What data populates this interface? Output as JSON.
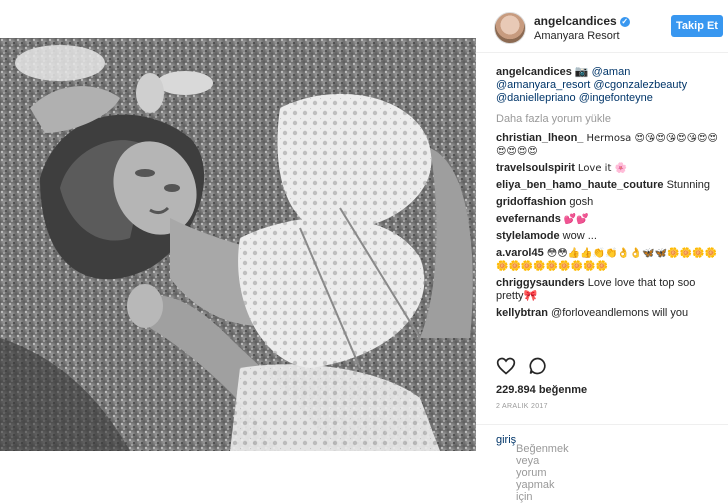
{
  "post": {
    "username": "angelcandices",
    "location": "Amanyara Resort",
    "follow_label": "Takip Et",
    "caption_user": "angelcandices",
    "caption_text": "📷 @aman @amanyara_resort @cgonzalezbeauty @daniellepriano @ingefonteyne",
    "load_more": "Daha fazla yorum yükle",
    "likes": "229.894 beğenme",
    "date": "2 ARALIK 2017",
    "footer_text": "Beğenmek veya yorum yapmak için ",
    "footer_link": "giriş"
  },
  "comments": [
    {
      "user": "christian_lheon_",
      "text": "Hermosa 😍😘😍😘😍😘😍😍😍😍😍😍"
    },
    {
      "user": "travelsoulspirit",
      "text": "Love it 🌸"
    },
    {
      "user": "eliya_ben_hamo_haute_couture",
      "text": "Stunning"
    },
    {
      "user": "gridoffashion",
      "text": "gosh"
    },
    {
      "user": "evefernands",
      "text": "💕💕"
    },
    {
      "user": "stylelamode",
      "text": "wow ..."
    },
    {
      "user": "a.varol45",
      "text": "😳😳👍👍👏👏👌👌🦋🦋🌼🌼🌼🌼🌼🌼🌼🌼🌼🌼🌼🌼🌼"
    },
    {
      "user": "chriggysaunders",
      "text": "Love love that top soo pretty🎀"
    },
    {
      "user": "kellybtran",
      "text": "@forloveandlemons will you"
    }
  ],
  "icons": {
    "heart": "heart-icon",
    "comment": "comment-icon",
    "verified": "verified-icon"
  },
  "colors": {
    "accent": "#3897f0",
    "link": "#003569"
  }
}
